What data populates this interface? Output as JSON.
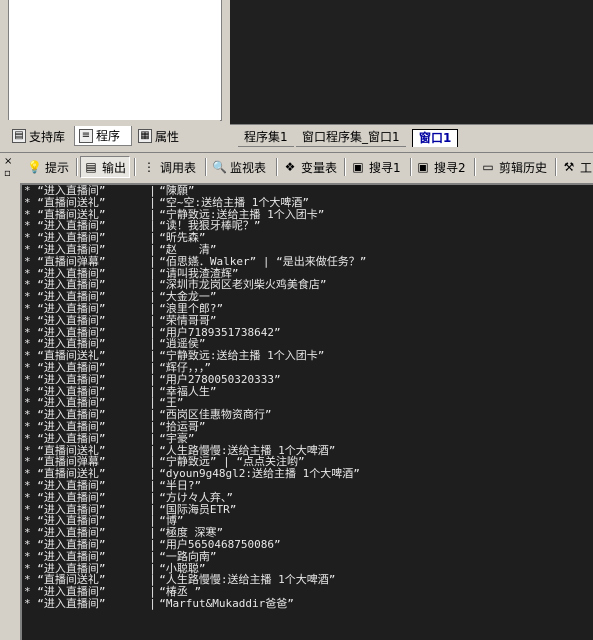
{
  "left_tabs": [
    {
      "label": "支持库",
      "icon": "library-icon"
    },
    {
      "label": "程序",
      "icon": "program-icon"
    },
    {
      "label": "属性",
      "icon": "properties-icon"
    }
  ],
  "editor_tabs": [
    "程序集1",
    "窗口程序集_窗口1",
    "窗口1"
  ],
  "toolbar": {
    "buttons": [
      {
        "label": "提示",
        "icon": "hint-icon"
      },
      {
        "label": "输出",
        "icon": "output-icon"
      },
      {
        "label": "调用表",
        "icon": "call-table-icon"
      },
      {
        "label": "监视表",
        "icon": "watch-icon"
      },
      {
        "label": "变量表",
        "icon": "variable-icon"
      },
      {
        "label": "搜寻1",
        "icon": "search1-icon"
      },
      {
        "label": "搜寻2",
        "icon": "search2-icon"
      },
      {
        "label": "剪辑历史",
        "icon": "clip-history-icon"
      },
      {
        "label": "工",
        "icon": "tools-icon"
      }
    ]
  },
  "output_lines": [
    {
      "type": "“进入直播间”",
      "text": "“陳願”"
    },
    {
      "type": "“直播间送礼”",
      "text": "“空~空:送给主播 1个大啤酒”"
    },
    {
      "type": "“直播间送礼”",
      "text": "“宁静致远:送给主播 1个入团卡”"
    },
    {
      "type": "“进入直播间”",
      "text": "“读！我狠牙棒呢？”"
    },
    {
      "type": "“进入直播间”",
      "text": "“昕先森”"
    },
    {
      "type": "“进入直播间”",
      "text": "“赵　　清”"
    },
    {
      "type": "“直播间弹幕”",
      "text": "“佰思嬿．Walker” | “是出来做任务？”"
    },
    {
      "type": "“进入直播间”",
      "text": "“请叫我渣渣辉”"
    },
    {
      "type": "“进入直播间”",
      "text": "“深圳市龙岗区老刘柴火鸡美食店”"
    },
    {
      "type": "“进入直播间”",
      "text": "“大金龙一”"
    },
    {
      "type": "“进入直播间”",
      "text": "“浪里个郎?”"
    },
    {
      "type": "“进入直播间”",
      "text": "“荣情哥哥”"
    },
    {
      "type": "“进入直播间”",
      "text": "“用户7189351738642”"
    },
    {
      "type": "“进入直播间”",
      "text": "“逍遥侯”"
    },
    {
      "type": "“直播间送礼”",
      "text": "“宁静致远:送给主播 1个入团卡”"
    },
    {
      "type": "“进入直播间”",
      "text": "“辉仔，，，”"
    },
    {
      "type": "“进入直播间”",
      "text": "“用户2780050320333”"
    },
    {
      "type": "“进入直播间”",
      "text": "“幸福人生”"
    },
    {
      "type": "“进入直播间”",
      "text": "“王”"
    },
    {
      "type": "“进入直播间”",
      "text": "“西岗区佳惠物资商行”"
    },
    {
      "type": "“进入直播间”",
      "text": "“拾运哥”"
    },
    {
      "type": "“进入直播间”",
      "text": "“宇豪”"
    },
    {
      "type": "“直播间送礼”",
      "text": "“人生路慢慢:送给主播 1个大啤酒”"
    },
    {
      "type": "“直播间弹幕”",
      "text": "“宁静致远” | “点点关注哟”"
    },
    {
      "type": "“直播间送礼”",
      "text": "“dyoun9g48gl2:送给主播 1个大啤酒”"
    },
    {
      "type": "“进入直播间”",
      "text": "“半日?”"
    },
    {
      "type": "“进入直播间”",
      "text": "“方け々人弃、”"
    },
    {
      "type": "“进入直播间”",
      "text": "“国际海员ETR”"
    },
    {
      "type": "“进入直播间”",
      "text": "“博”"
    },
    {
      "type": "“进入直播间”",
      "text": "“極度 深寒”"
    },
    {
      "type": "“进入直播间”",
      "text": "“用户5650468750086”"
    },
    {
      "type": "“进入直播间”",
      "text": "“一路向南”"
    },
    {
      "type": "“进入直播间”",
      "text": "“小聪聪”"
    },
    {
      "type": "“直播间送礼”",
      "text": "“人生路慢慢:送给主播 1个大啤酒”"
    },
    {
      "type": "“进入直播间”",
      "text": "“椿丞 ”"
    },
    {
      "type": "“进入直播间”",
      "text": "“Marfut&Mukaddir爸爸”"
    }
  ],
  "colors": {
    "output_bg": "#1e1e1e",
    "output_text": "#e8e8e8",
    "chrome": "#d4d0c8",
    "active_tab_text": "#0000a0"
  }
}
